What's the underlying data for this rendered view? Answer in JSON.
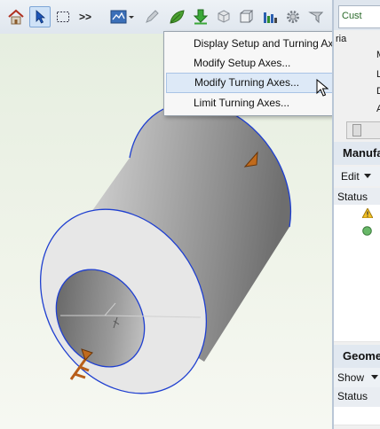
{
  "toolbar": {
    "icons": [
      "home-icon",
      "select-arrow-icon",
      "box-select-icon",
      "more-chevrons-icon",
      "view-setup-icon",
      "pen-icon",
      "leaf-icon",
      "download-arrow-icon",
      "rotate-cube-icon",
      "wireframe-cube-icon",
      "bar-chart-icon",
      "gear-icon",
      "pointer-icon"
    ],
    "more_label": ">>"
  },
  "context_menu": {
    "items": [
      {
        "label": "Display Setup and Turning Axes..."
      },
      {
        "label": "Modify Setup Axes..."
      },
      {
        "label": "Modify Turning Axes..."
      },
      {
        "label": "Limit Turning Axes..."
      }
    ],
    "hovered_index": 2
  },
  "right_panel": {
    "tab_label": "Cust",
    "partial_labels": [
      "ria",
      "M",
      "L",
      "D",
      "A"
    ],
    "manufacturing": {
      "header": "Manufa",
      "edit_label": "Edit",
      "column_status": "Status"
    },
    "geometry": {
      "header": "Geome",
      "show_label": "Show",
      "column_status": "Status"
    }
  },
  "colors": {
    "outline": "#1f3fd0",
    "menu_hover": "#dde9f7",
    "toolbar": "#e6ecf2"
  }
}
